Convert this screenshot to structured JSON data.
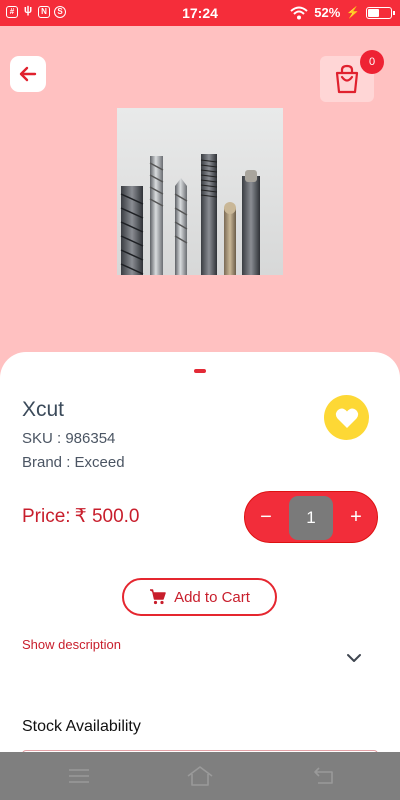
{
  "status_bar": {
    "time": "17:24",
    "battery": "52%",
    "battery_level": 0.52,
    "left_icons": [
      "grid-icon",
      "usb-icon",
      "notification-icon",
      "skype-icon"
    ]
  },
  "header": {
    "back_icon": "arrow-left-icon",
    "cart_icon": "shopping-bag-icon",
    "cart_count": "0"
  },
  "product": {
    "name": "Xcut",
    "sku": "SKU : 986354",
    "brand": "Brand : Exceed",
    "price_label": "Price:",
    "price_value": "₹ 500.0",
    "quantity": "1"
  },
  "stepper": {
    "minus": "−",
    "plus": "+"
  },
  "actions": {
    "add_to_cart": "Add to Cart",
    "show_description": "Show description"
  },
  "sections": {
    "stock_title": "Stock Availability"
  },
  "colors": {
    "accent": "#f52d3a",
    "header_bg": "#ffc1c1",
    "favorite": "#fdd835"
  }
}
